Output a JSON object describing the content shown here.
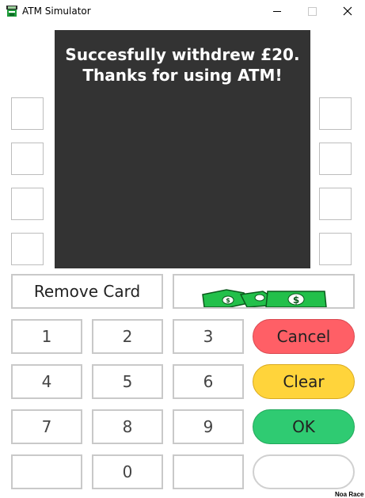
{
  "window": {
    "title": "ATM Simulator"
  },
  "screen": {
    "message": "Succesfully withdrew £20.\n Thanks for using ATM!"
  },
  "remove_card": {
    "label": "Remove Card"
  },
  "keypad": {
    "k1": "1",
    "k2": "2",
    "k3": "3",
    "k4": "4",
    "k5": "5",
    "k6": "6",
    "k7": "7",
    "k8": "8",
    "k9": "9",
    "k0": "0"
  },
  "actions": {
    "cancel": "Cancel",
    "clear": "Clear",
    "ok": "OK",
    "blank": ""
  },
  "footer": {
    "corner_text": "Noa Race"
  },
  "colors": {
    "screen_bg": "#333333",
    "cancel": "#ff5f66",
    "clear": "#ffd43b",
    "ok": "#2fcb72",
    "cash_green": "#22c04a"
  },
  "icons": {
    "app": "atm-icon",
    "cash": "money-icon"
  }
}
